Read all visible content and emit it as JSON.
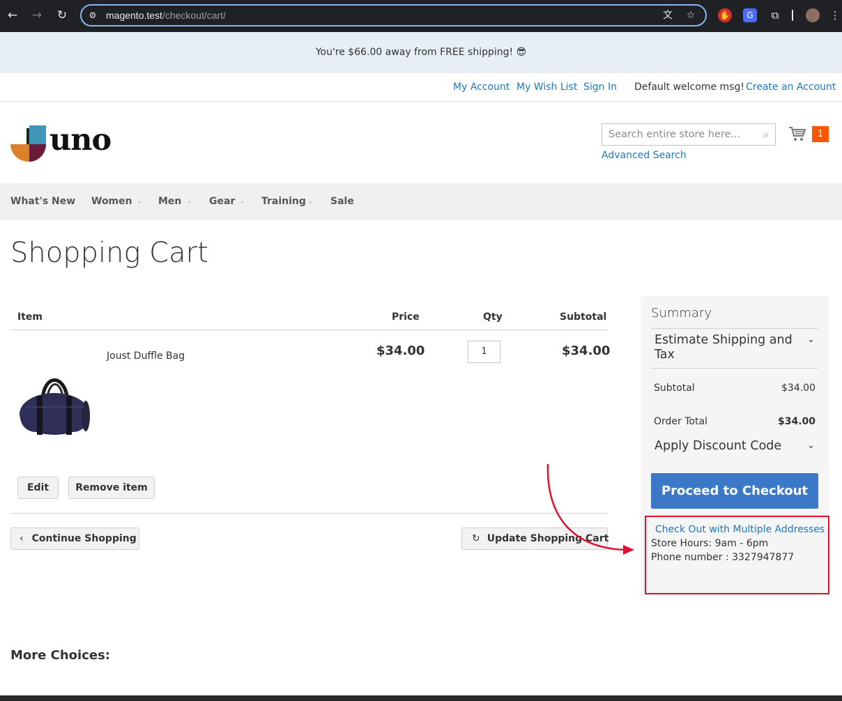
{
  "browser": {
    "url_host": "magento.test",
    "url_path": "/checkout/cart/"
  },
  "promo": {
    "text": "You're $66.00 away from FREE shipping! 😎"
  },
  "header": {
    "my_account": "My Account",
    "wish_list": "My Wish List",
    "sign_in": "Sign In",
    "welcome": "Default welcome msg!",
    "create_account": "Create an Account",
    "logo_text": "uno",
    "search_placeholder": "Search entire store here...",
    "advanced_search": "Advanced Search",
    "cart_count": "1"
  },
  "nav": {
    "items": [
      "What's New",
      "Women",
      "Men",
      "Gear",
      "Training",
      "Sale"
    ]
  },
  "page": {
    "title": "Shopping Cart"
  },
  "cart": {
    "headers": {
      "item": "Item",
      "price": "Price",
      "qty": "Qty",
      "subtotal": "Subtotal"
    },
    "items": [
      {
        "name": "Joust Duffle Bag",
        "price": "$34.00",
        "qty": "1",
        "subtotal": "$34.00"
      }
    ],
    "edit_label": "Edit",
    "remove_label": "Remove item",
    "continue_label": "Continue Shopping",
    "update_label": "Update Shopping Cart"
  },
  "summary": {
    "title": "Summary",
    "estimate_title": "Estimate Shipping and Tax",
    "subtotal_label": "Subtotal",
    "subtotal_value": "$34.00",
    "order_total_label": "Order Total",
    "order_total_value": "$34.00",
    "discount_title": "Apply Discount Code",
    "checkout_label": "Proceed to Checkout",
    "multi_address_label": "Check Out with Multiple Addresses",
    "store_hours": "Store Hours: 9am - 6pm",
    "phone": "Phone number : 3327947877"
  },
  "more_choices": "More Choices:",
  "colors": {
    "link": "#1979c3",
    "checkout_button": "#3b79c8",
    "cart_badge": "#ff5501",
    "annotation": "#e0102f"
  }
}
